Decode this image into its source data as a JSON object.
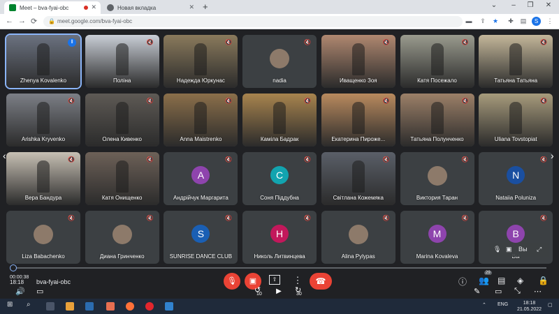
{
  "browser": {
    "tabs": [
      {
        "title": "Meet – bva-fyai-obc"
      },
      {
        "title": "Новая вкладка"
      }
    ],
    "url": "meet.google.com/bva-fyai-obc",
    "profile_initial": "S"
  },
  "tiles": [
    {
      "name": "Zhenya Kovalenko",
      "type": "video",
      "bg": "#6b7280",
      "speaking": true
    },
    {
      "name": "Поліна",
      "type": "video",
      "bg": "#c9ced6"
    },
    {
      "name": "Надежда Юркунас",
      "type": "video",
      "bg": "#8a7a5c"
    },
    {
      "name": "nadia",
      "type": "photo"
    },
    {
      "name": "Иващенко Зоя",
      "type": "video",
      "bg": "#b08870"
    },
    {
      "name": "Катя Посежало",
      "type": "video",
      "bg": "#9a9b8e"
    },
    {
      "name": "Татьяна Татьяна",
      "type": "video",
      "bg": "#c4b79a"
    },
    {
      "name": "Arishka Kryvenko",
      "type": "video",
      "bg": "#7c7f86"
    },
    {
      "name": "Олена Кивенко",
      "type": "video",
      "bg": "#5e5a55"
    },
    {
      "name": "Anna Maistrenko",
      "type": "video",
      "bg": "#8b6f4a"
    },
    {
      "name": "Каміла Бадрак",
      "type": "video",
      "bg": "#a8844e"
    },
    {
      "name": "Екатерина Пироже...",
      "type": "video",
      "bg": "#b98a5e"
    },
    {
      "name": "Татьяна Полунченко",
      "type": "video",
      "bg": "#9c8068"
    },
    {
      "name": "Uliana Tovstopiat",
      "type": "video",
      "bg": "#a79b7c"
    },
    {
      "name": "Вера Бандура",
      "type": "video",
      "bg": "#c7c0b4"
    },
    {
      "name": "Катя Онищенко",
      "type": "video",
      "bg": "#6d6158"
    },
    {
      "name": "Андрійчук Маргарита",
      "type": "avatar",
      "initial": "A",
      "color": "#8e44ad"
    },
    {
      "name": "Соня Піддубна",
      "type": "avatar",
      "initial": "C",
      "color": "#12a4af"
    },
    {
      "name": "Світлана Кожемяка",
      "type": "video",
      "bg": "#5a5f68"
    },
    {
      "name": "Виктория Таран",
      "type": "photo"
    },
    {
      "name": "Nataiia Poluniza",
      "type": "avatar",
      "initial": "N",
      "color": "#1a4fa0"
    },
    {
      "name": "Liza Babachenko",
      "type": "photo"
    },
    {
      "name": "Диана Гринченко",
      "type": "photo"
    },
    {
      "name": "SUNRISE DANCE CLUB",
      "type": "avatar",
      "initial": "S",
      "color": "#1a5fb4"
    },
    {
      "name": "Николь Литвинцева",
      "type": "avatar",
      "initial": "H",
      "color": "#c2185b"
    },
    {
      "name": "Alina Pylypas",
      "type": "photo"
    },
    {
      "name": "Marina Kovaleva",
      "type": "avatar",
      "initial": "M",
      "color": "#8e44ad"
    },
    {
      "name": "Вы",
      "type": "avatar",
      "initial": "B",
      "color": "#8e44ad"
    }
  ],
  "bottom": {
    "position": "00:00:38",
    "clock": "18:18",
    "meeting_code": "bva-fyai-obc",
    "participants_count": "29",
    "skip_back": "10",
    "skip_forward": "30",
    "self_label": "Вы"
  },
  "taskbar": {
    "lang": "ENG",
    "time": "18:18",
    "date": "21.05.2022"
  }
}
